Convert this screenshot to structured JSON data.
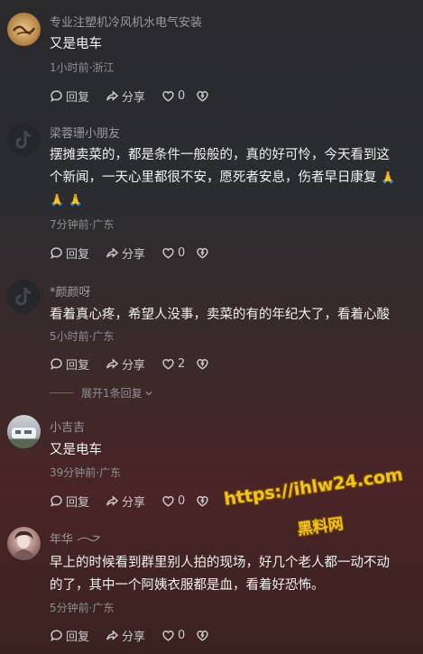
{
  "comments": [
    {
      "username": "专业注塑机冷风机水电气安装",
      "content": "又是电车",
      "meta": "1小时前·浙江",
      "reply_label": "回复",
      "share_label": "分享",
      "like_count": "0"
    },
    {
      "username": "梁蓉珊小朋友",
      "content_line1": "摆摊卖菜的，都是条件一般般的，真的好可怜，今天看到这",
      "content_line2": "个新闻，一天心里都很不安，愿死者安息，伤者早日康复",
      "content_emoji": "🙏",
      "meta": "7分钟前·广东",
      "reply_label": "回复",
      "share_label": "分享",
      "like_count": "0"
    },
    {
      "username": "*颜颜呀",
      "content": "看着真心疼，希望人没事，卖菜的有的年纪大了，看着心酸",
      "meta": "5小时前·广东",
      "reply_label": "回复",
      "share_label": "分享",
      "like_count": "2",
      "expand_replies": "展开1条回复"
    },
    {
      "username": "小吉吉",
      "content": "又是电车",
      "meta": "39分钟前·广东",
      "reply_label": "回复",
      "share_label": "分享",
      "like_count": "0"
    },
    {
      "username": "年华",
      "content_line1": "早上的时候看到群里别人拍的现场，好几个老人都一动不动",
      "content_line2": "的了，其中一个阿姨衣服都是血，看着好恐怖。",
      "meta": "5分钟前·广东",
      "reply_label": "回复",
      "share_label": "分享",
      "like_count": "0"
    }
  ],
  "watermark": {
    "url": "https://ihlw24.com",
    "brand": "黑料网"
  },
  "colors": {
    "accent_watermark": "#f4c21c",
    "text_primary": "#f1f1f2",
    "text_secondary": "#8f8f93"
  }
}
